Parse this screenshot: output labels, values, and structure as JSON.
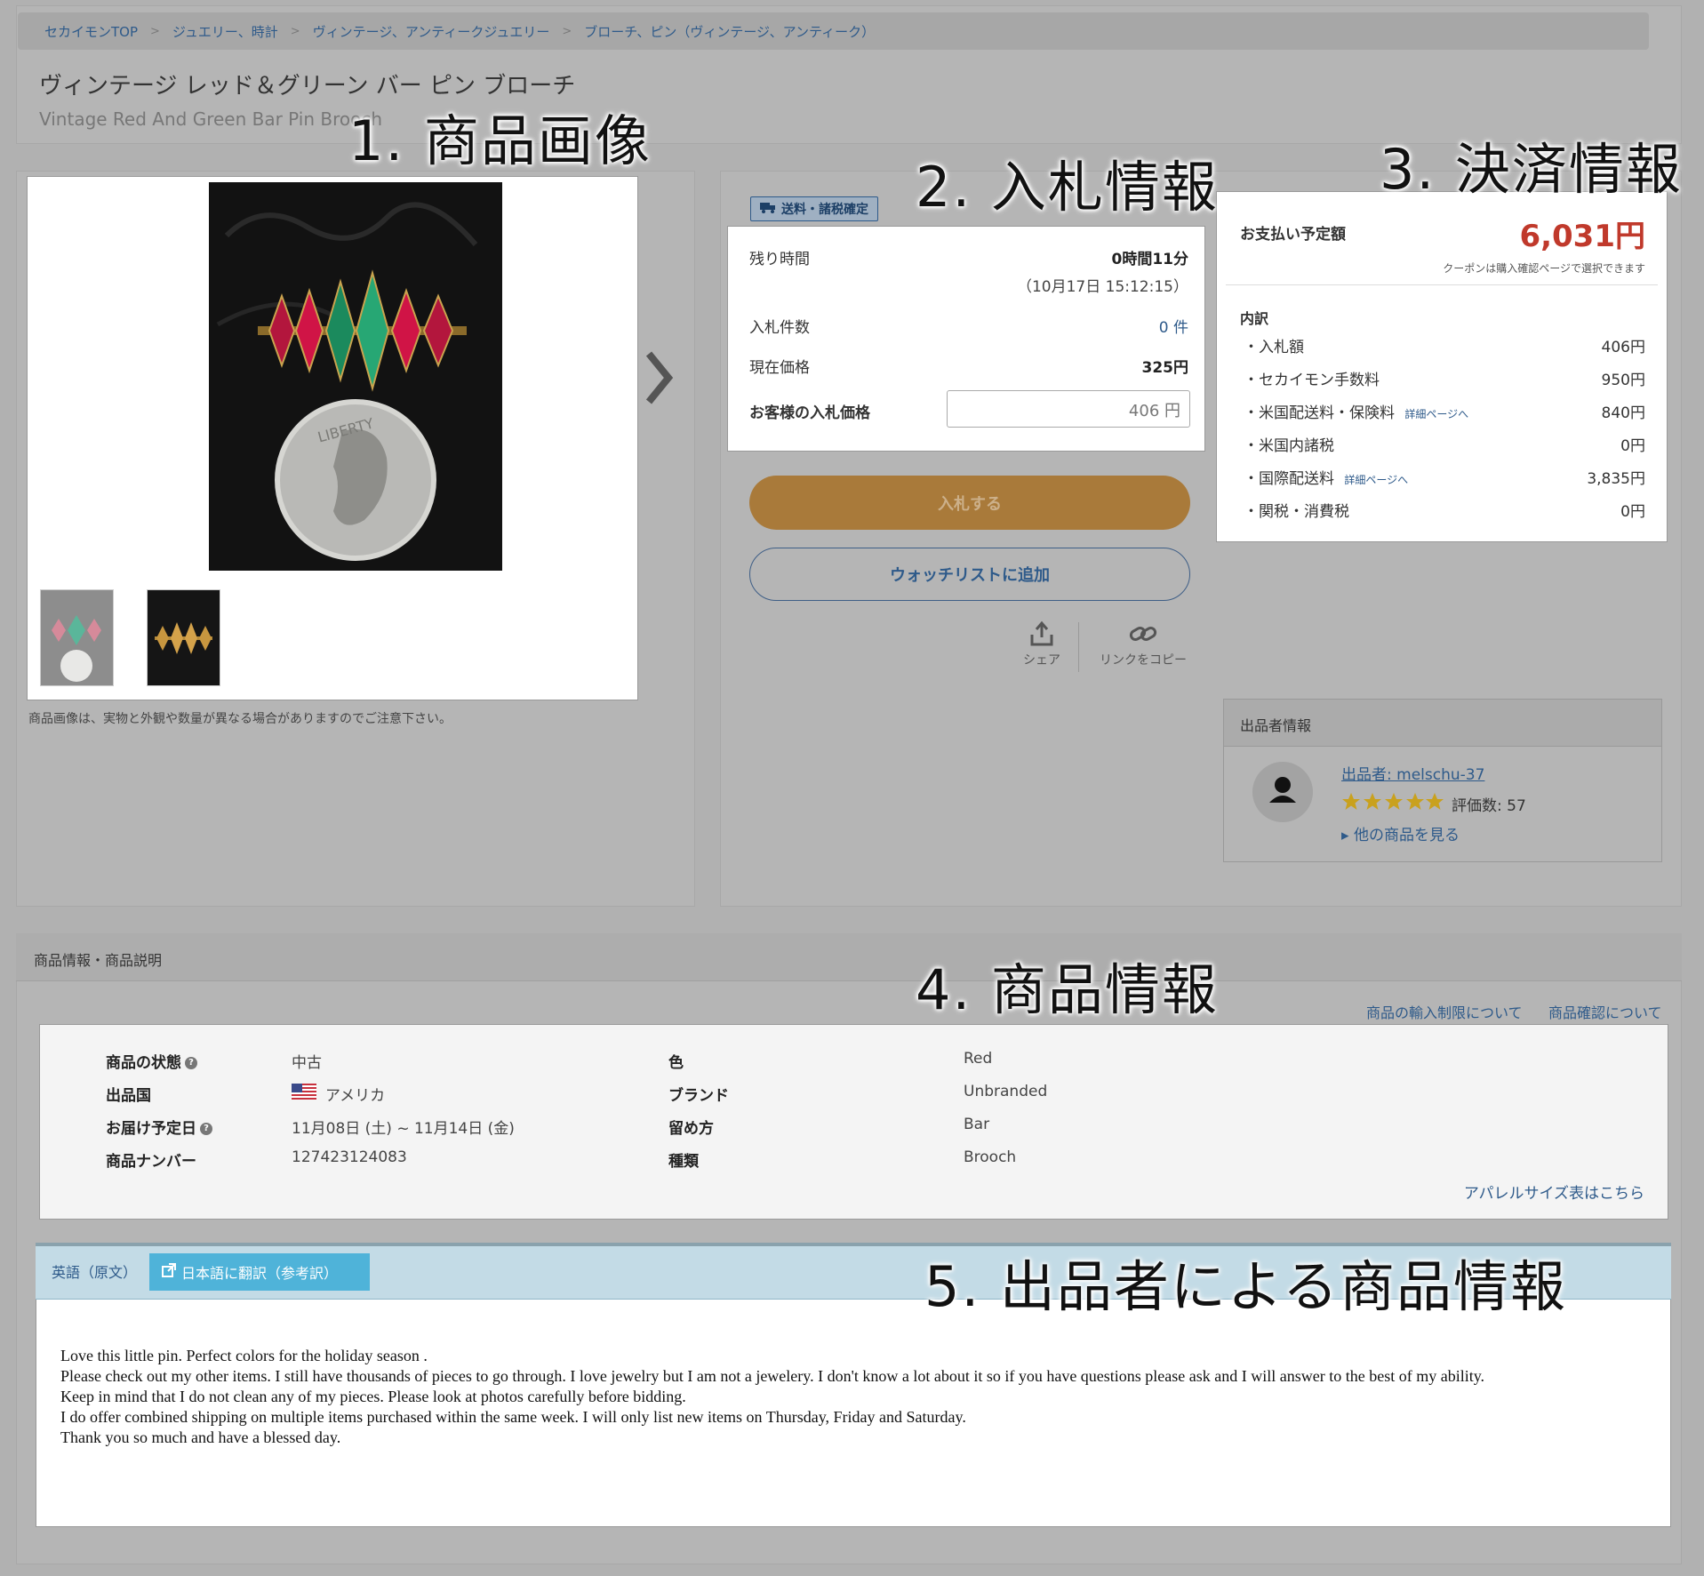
{
  "breadcrumb": [
    "セカイモンTOP",
    "ジュエリー、時計",
    "ヴィンテージ、アンティークジュエリー",
    "ブローチ、ピン（ヴィンテージ、アンティーク）"
  ],
  "title_jp": "ヴィンテージ レッド＆グリーン バー ピン ブローチ",
  "title_en": "Vintage Red And Green Bar Pin Brooch",
  "annotations": {
    "a1": "1.  商品画像",
    "a2": "2.  入札情報",
    "a3": "3.  決済情報",
    "a4": "4.  商品情報",
    "a5": "5.  出品者による商品情報"
  },
  "image_note": "商品画像は、実物と外観や数量が異なる場合がありますのでご注意下さい。",
  "bid": {
    "badge": "送料・諸税確定",
    "time_left_label": "残り時間",
    "time_left_value": "0時間11分",
    "end_time": "（10月17日 15:12:15）",
    "bid_count_label": "入札件数",
    "bid_count_value": "0 件",
    "current_price_label": "現在価格",
    "current_price_value": "325円",
    "your_bid_label": "お客様の入札価格",
    "your_bid_value": "406 円",
    "bid_button": "入札する",
    "watch_button": "ウォッチリストに追加",
    "share_label": "シェア",
    "copy_link_label": "リンクをコピー"
  },
  "payment": {
    "title": "お支払い予定額",
    "total": "6,031円",
    "coupon_note": "クーポンは購入確認ページで選択できます",
    "breakdown_title": "内訳",
    "detail_link": "詳細ページへ",
    "items": [
      {
        "label": "・入札額",
        "amount": "406円"
      },
      {
        "label": "・セカイモン手数料",
        "amount": "950円"
      },
      {
        "label": "・米国配送料・保険料",
        "amount": "840円"
      },
      {
        "label": "・米国内諸税",
        "amount": "0円"
      },
      {
        "label": "・国際配送料",
        "amount": "3,835円"
      },
      {
        "label": "・関税・消費税",
        "amount": "0円"
      }
    ],
    "total_color": "#c0392b"
  },
  "seller": {
    "header": "出品者情報",
    "name": "出品者: melschu-37",
    "rating_count": "評価数: 57",
    "stars": 5,
    "other_items": "他の商品を見る"
  },
  "product_info": {
    "section_title": "商品情報・商品説明",
    "import_link": "商品の輸入制限について",
    "check_link": "商品確認について",
    "rows_left": [
      {
        "label": "商品の状態",
        "value": "中古"
      },
      {
        "label": "出品国",
        "value": "アメリカ"
      },
      {
        "label": "お届け予定日",
        "value": "11月08日 (土) ~ 11月14日 (金)"
      },
      {
        "label": "商品ナンバー",
        "value": "127423124083"
      }
    ],
    "rows_right": [
      {
        "label": "色",
        "value": "Red"
      },
      {
        "label": "ブランド",
        "value": "Unbranded"
      },
      {
        "label": "留め方",
        "value": "Bar"
      },
      {
        "label": "種類",
        "value": "Brooch"
      }
    ],
    "apparel_link": "アパレルサイズ表はこちら"
  },
  "description": {
    "tab_original": "英語（原文）",
    "translate_button": "日本語に翻訳（参考訳）",
    "lines": [
      "Love this little pin. Perfect colors for the holiday season .",
      "Please check out my other items. I still have thousands of pieces to go through. I love jewelry but I am not a jewelery. I don't know a lot about it so if you have questions please ask and I will answer to the best of my ability.",
      "Keep in mind that I do not clean any of my pieces. Please look at photos carefully before bidding.",
      "I do offer combined shipping on multiple items purchased within the same week. I will only list new items on Thursday, Friday and Saturday.",
      "Thank you so much and have a blessed day."
    ]
  }
}
